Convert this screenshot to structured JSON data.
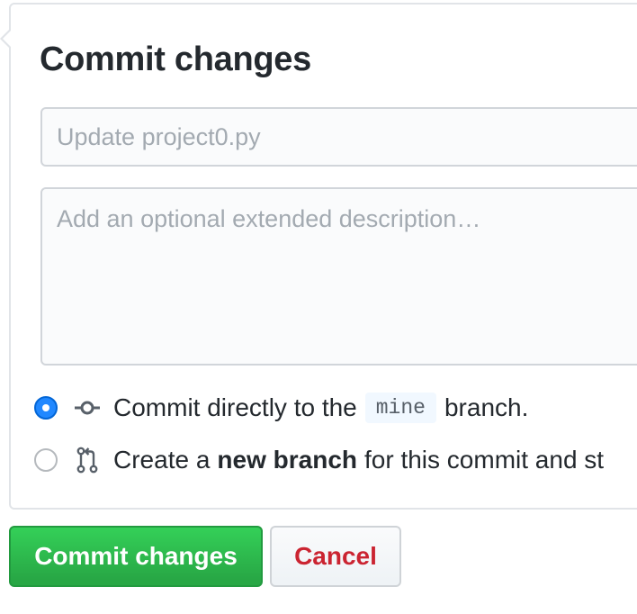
{
  "commit_form": {
    "title": "Commit changes",
    "summary_placeholder": "Update project0.py",
    "summary_value": "",
    "description_placeholder": "Add an optional extended description…",
    "description_value": "",
    "option_direct": {
      "selected": true,
      "icon": "git-commit-icon",
      "text_before": "Commit directly to the",
      "branch_name": "mine",
      "text_after": "branch."
    },
    "option_new_branch": {
      "selected": false,
      "icon": "git-pull-request-icon",
      "text_before": "Create a",
      "text_bold": "new branch",
      "text_after": "for this commit and st"
    }
  },
  "actions": {
    "commit_label": "Commit changes",
    "cancel_label": "Cancel"
  },
  "colors": {
    "accent_blue": "#2188ff",
    "commit_green": "#28a745",
    "cancel_red": "#cb2431",
    "border_gray": "#e1e4e8"
  }
}
